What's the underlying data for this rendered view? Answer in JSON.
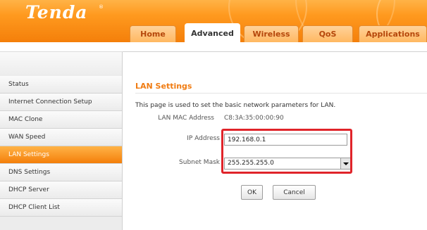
{
  "brand": {
    "logo_text": "Tenda",
    "reg_mark": "®"
  },
  "tabs": [
    {
      "label": "Home"
    },
    {
      "label": "Advanced",
      "active": true
    },
    {
      "label": "Wireless"
    },
    {
      "label": "QoS"
    },
    {
      "label": "Applications"
    }
  ],
  "sidebar": {
    "items": [
      {
        "label": "Status"
      },
      {
        "label": "Internet Connection Setup"
      },
      {
        "label": "MAC Clone"
      },
      {
        "label": "WAN Speed"
      },
      {
        "label": "LAN Settings",
        "active": true
      },
      {
        "label": "DNS Settings"
      },
      {
        "label": "DHCP Server"
      },
      {
        "label": "DHCP Client List"
      }
    ]
  },
  "main": {
    "title": "LAN Settings",
    "description": "This page is used to set the basic network parameters for LAN.",
    "mac_label": "LAN MAC Address",
    "mac_value": "C8:3A:35:00:00:90",
    "ip_label": "IP Address",
    "ip_value": "192.168.0.1",
    "mask_label": "Subnet Mask",
    "mask_value": "255.255.255.0",
    "ok_label": "OK",
    "cancel_label": "Cancel"
  },
  "colors": {
    "accent": "#f47f0a",
    "title": "#f07c13",
    "highlight": "#e0242a"
  }
}
